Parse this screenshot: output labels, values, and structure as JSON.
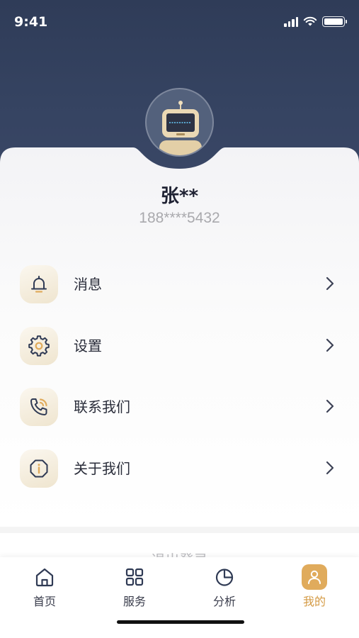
{
  "status_bar": {
    "time": "9:41"
  },
  "profile": {
    "name": "张**",
    "phone": "188****5432"
  },
  "menu": [
    {
      "label": "消息",
      "icon": "bell-icon"
    },
    {
      "label": "设置",
      "icon": "gear-icon"
    },
    {
      "label": "联系我们",
      "icon": "phone-icon"
    },
    {
      "label": "关于我们",
      "icon": "info-icon"
    }
  ],
  "logout": {
    "label": "退出登录"
  },
  "tabbar": {
    "tabs": [
      {
        "label": "首页",
        "icon": "home-icon"
      },
      {
        "label": "服务",
        "icon": "grid-icon"
      },
      {
        "label": "分析",
        "icon": "pie-chart-icon"
      },
      {
        "label": "我的",
        "icon": "user-icon",
        "active": true
      }
    ]
  },
  "colors": {
    "header": "#2f3c58",
    "accent": "#e0ab5c",
    "icon_dark": "#2f3a54"
  }
}
